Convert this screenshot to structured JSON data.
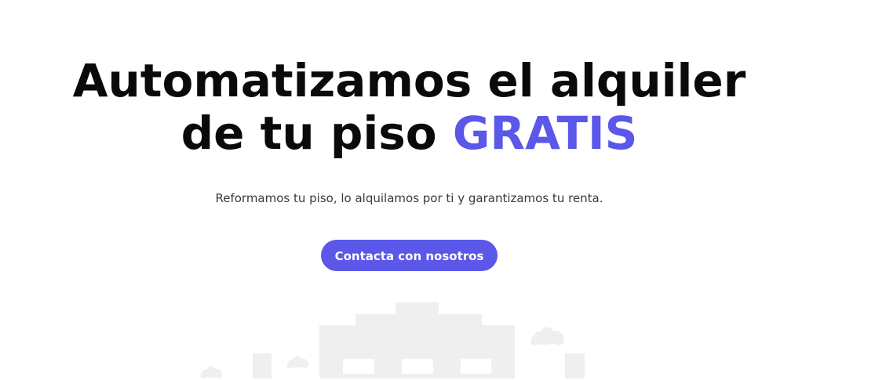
{
  "hero": {
    "title_line1": "Automatizamos el alquiler",
    "title_line2_prefix": "de tu piso ",
    "title_accent": "GRATIS",
    "subtitle": "Reformamos tu piso, lo alquilamos por ti y garantizamos tu renta.",
    "cta_label": "Contacta con nosotros"
  },
  "colors": {
    "accent": "#5b57e8",
    "illustration": "#efefef"
  },
  "illustration": {
    "icons": [
      "building-icon",
      "cloud-icon"
    ]
  }
}
